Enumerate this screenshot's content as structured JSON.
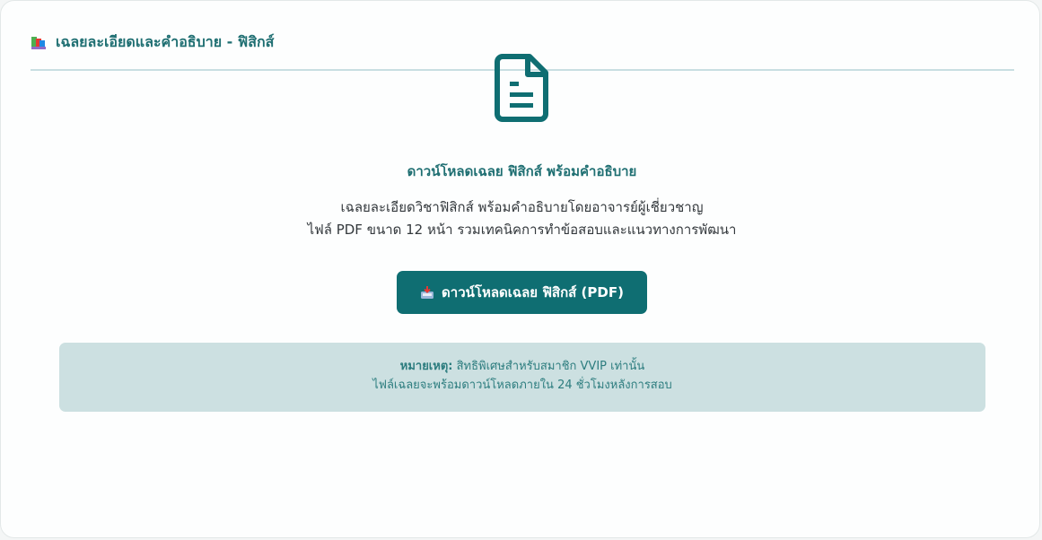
{
  "header": {
    "icon": "books-icon",
    "title": "เฉลยละเอียดและคำอธิบาย - ฟิสิกส์"
  },
  "main": {
    "icon": "document-icon",
    "title": "ดาวน์โหลดเฉลย ฟิสิกส์ พร้อมคำอธิบาย",
    "description_line1": "เฉลยละเอียดวิชาฟิสิกส์ พร้อมคำอธิบายโดยอาจารย์ผู้เชี่ยวชาญ",
    "description_line2": "ไฟล์ PDF ขนาด 12 หน้า รวมเทคนิคการทำข้อสอบและแนวทางการพัฒนา",
    "button_icon": "inbox-tray-icon",
    "button_label": "ดาวน์โหลดเฉลย ฟิสิกส์ (PDF)"
  },
  "note": {
    "label": "หมายเหตุ:",
    "line1": " สิทธิพิเศษสำหรับสมาชิก VVIP เท่านั้น",
    "line2": "ไฟล์เฉลยจะพร้อมดาวน์โหลดภายใน 24 ชั่วโมงหลังการสอบ"
  },
  "colors": {
    "accent": "#0f6e72",
    "title_text": "#1f6f72",
    "note_bg": "#cce0e1",
    "divider": "#c8dfe2"
  }
}
